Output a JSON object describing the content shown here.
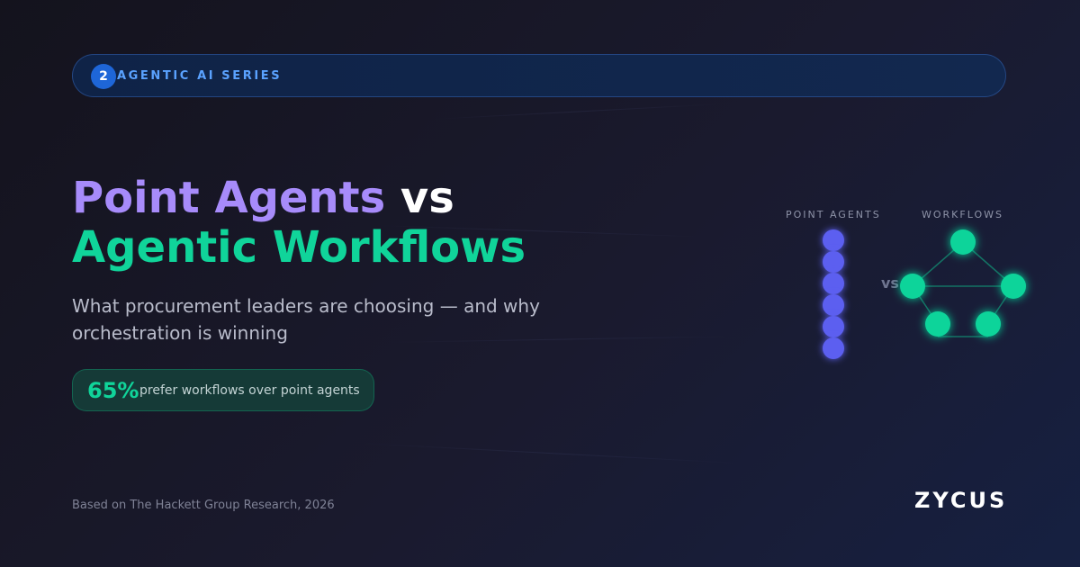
{
  "series": {
    "number": "2",
    "label": "AGENTIC AI SERIES"
  },
  "headline": {
    "part1": "Point Agents",
    "part2": " vs",
    "part3": "Agentic Workflows"
  },
  "subtitle": "What procurement leaders are choosing — and why orchestration is winning",
  "stat": {
    "value": "65%",
    "text": "prefer workflows over point agents"
  },
  "diagram": {
    "left_label": "POINT AGENTS",
    "right_label": "WORKFLOWS",
    "vs_label": "vs",
    "point_agents_count": 6,
    "workflow_nodes_count": 5
  },
  "footer": {
    "source": "Based on The Hackett Group Research, 2026",
    "logo": "ZYCUS"
  },
  "colors": {
    "purple": "#a78bfa",
    "green": "#10d49a",
    "blue_accent": "#5aa2ff",
    "agent_node": "#5b5ff0",
    "workflow_node": "#10d49a"
  }
}
